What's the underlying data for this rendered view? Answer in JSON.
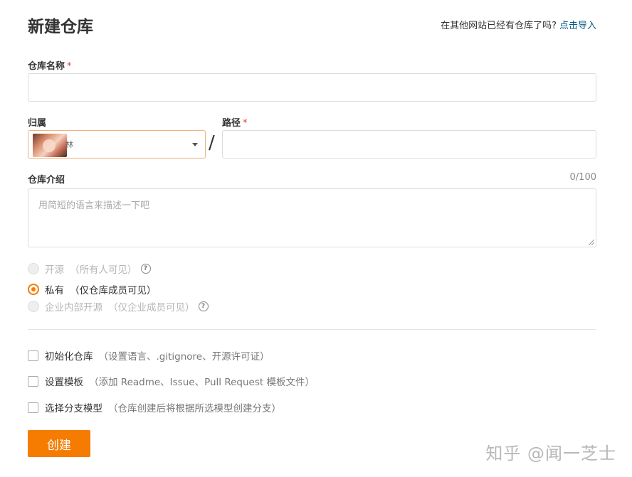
{
  "header": {
    "title": "新建仓库",
    "import_hint": "在其他网站已经有仓库了吗?",
    "import_link": "点击导入"
  },
  "repo_name": {
    "label": "仓库名称",
    "required_mark": "*",
    "value": ""
  },
  "owner": {
    "label": "归属",
    "name": "林"
  },
  "path": {
    "label": "路径",
    "required_mark": "*",
    "value": "",
    "separator": "/"
  },
  "description": {
    "label": "仓库介绍",
    "counter": "0/100",
    "placeholder": "用简短的语言来描述一下吧"
  },
  "visibility": {
    "options": [
      {
        "label": "开源",
        "note": "（所有人可见）",
        "state": "disabled",
        "help": true
      },
      {
        "label": "私有",
        "note": "（仅仓库成员可见）",
        "state": "checked",
        "help": false
      },
      {
        "label": "企业内部开源",
        "note": "（仅企业成员可见）",
        "state": "disabled",
        "help": true
      }
    ],
    "help_glyph": "?"
  },
  "options": [
    {
      "label": "初始化仓库",
      "note": "（设置语言、.gitignore、开源许可证）",
      "checked": false
    },
    {
      "label": "设置模板",
      "note": "（添加 Readme、Issue、Pull Request 模板文件）",
      "checked": false
    },
    {
      "label": "选择分支模型",
      "note": "（仓库创建后将根据所选模型创建分支）",
      "checked": false
    }
  ],
  "submit": {
    "label": "创建"
  },
  "watermark": "知乎 @闻一芝士",
  "colors": {
    "accent": "#f57c00",
    "link": "#005980",
    "required": "#e53935"
  }
}
